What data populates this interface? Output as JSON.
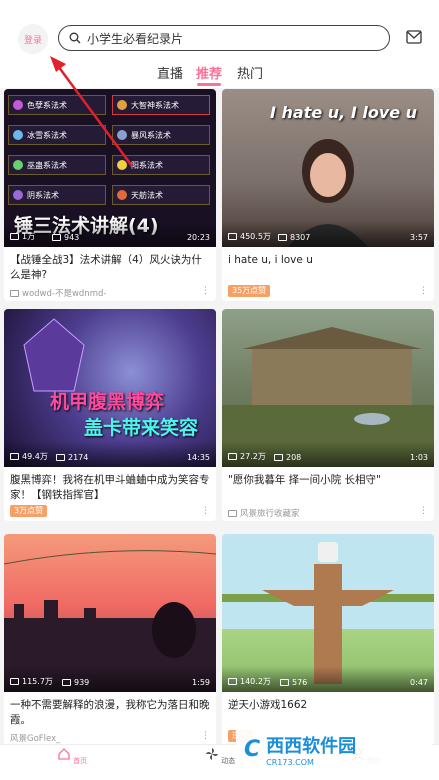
{
  "header": {
    "login_label": "登录",
    "search_placeholder": "小学生必看纪录片",
    "tabs": [
      {
        "label": "直播",
        "active": false
      },
      {
        "label": "推荐",
        "active": true
      },
      {
        "label": "热门",
        "active": false
      }
    ]
  },
  "feed": [
    {
      "views": "1万",
      "comments": "943",
      "duration": "20:23",
      "title": "【战锤全战3】法术讲解（4）风火诀为什么是神?",
      "uploader": "wodwd-不是wdnmd-",
      "thumb_caption": "锤三法术讲解(4)",
      "spells": [
        "色孽系法术",
        "大智神系法术",
        "冰雪系法术",
        "暴风系法术",
        "巫蛊系法术",
        "阳系法术",
        "阴系法术",
        "天舫法术"
      ]
    },
    {
      "views": "450.5万",
      "comments": "8307",
      "duration": "3:57",
      "title": "i hate u, i love u",
      "badge": "35万点赞",
      "thumb_caption": "I hate u, I love u"
    },
    {
      "views": "49.4万",
      "comments": "2174",
      "duration": "14:35",
      "title": "腹黑博弈！我将在机甲斗蛐蛐中成为笑容专家！【钢铁指挥官】",
      "badge": "3万点赞",
      "thumb_caption_1": "机甲腹黑博弈",
      "thumb_caption_2": "盖卡带来笑容"
    },
    {
      "views": "27.2万",
      "comments": "208",
      "duration": "1:03",
      "title": "\"愿你我暮年 择一间小院 长相守\"",
      "uploader": "风景旅行收藏家"
    },
    {
      "views": "115.7万",
      "comments": "939",
      "duration": "1:59",
      "title": "一种不需要解释的浪漫，我称它为落日和晚霞。",
      "uploader": "风景GoFlex_"
    },
    {
      "views": "140.2万",
      "comments": "576",
      "duration": "0:47",
      "title": "逆天小游戏1662",
      "badge": "逆天"
    }
  ],
  "bottom_nav": [
    {
      "label": "首页",
      "active": true,
      "icon": "home-icon"
    },
    {
      "label": "动态",
      "active": false,
      "icon": "fan-icon"
    },
    {
      "label": "我的",
      "active": false,
      "icon": "user-icon"
    }
  ],
  "watermark": {
    "logo": "C",
    "cn": "西西软件园",
    "en": "CR173.COM"
  },
  "colors": {
    "accent": "#fb7299",
    "badge": "#f7a066"
  }
}
